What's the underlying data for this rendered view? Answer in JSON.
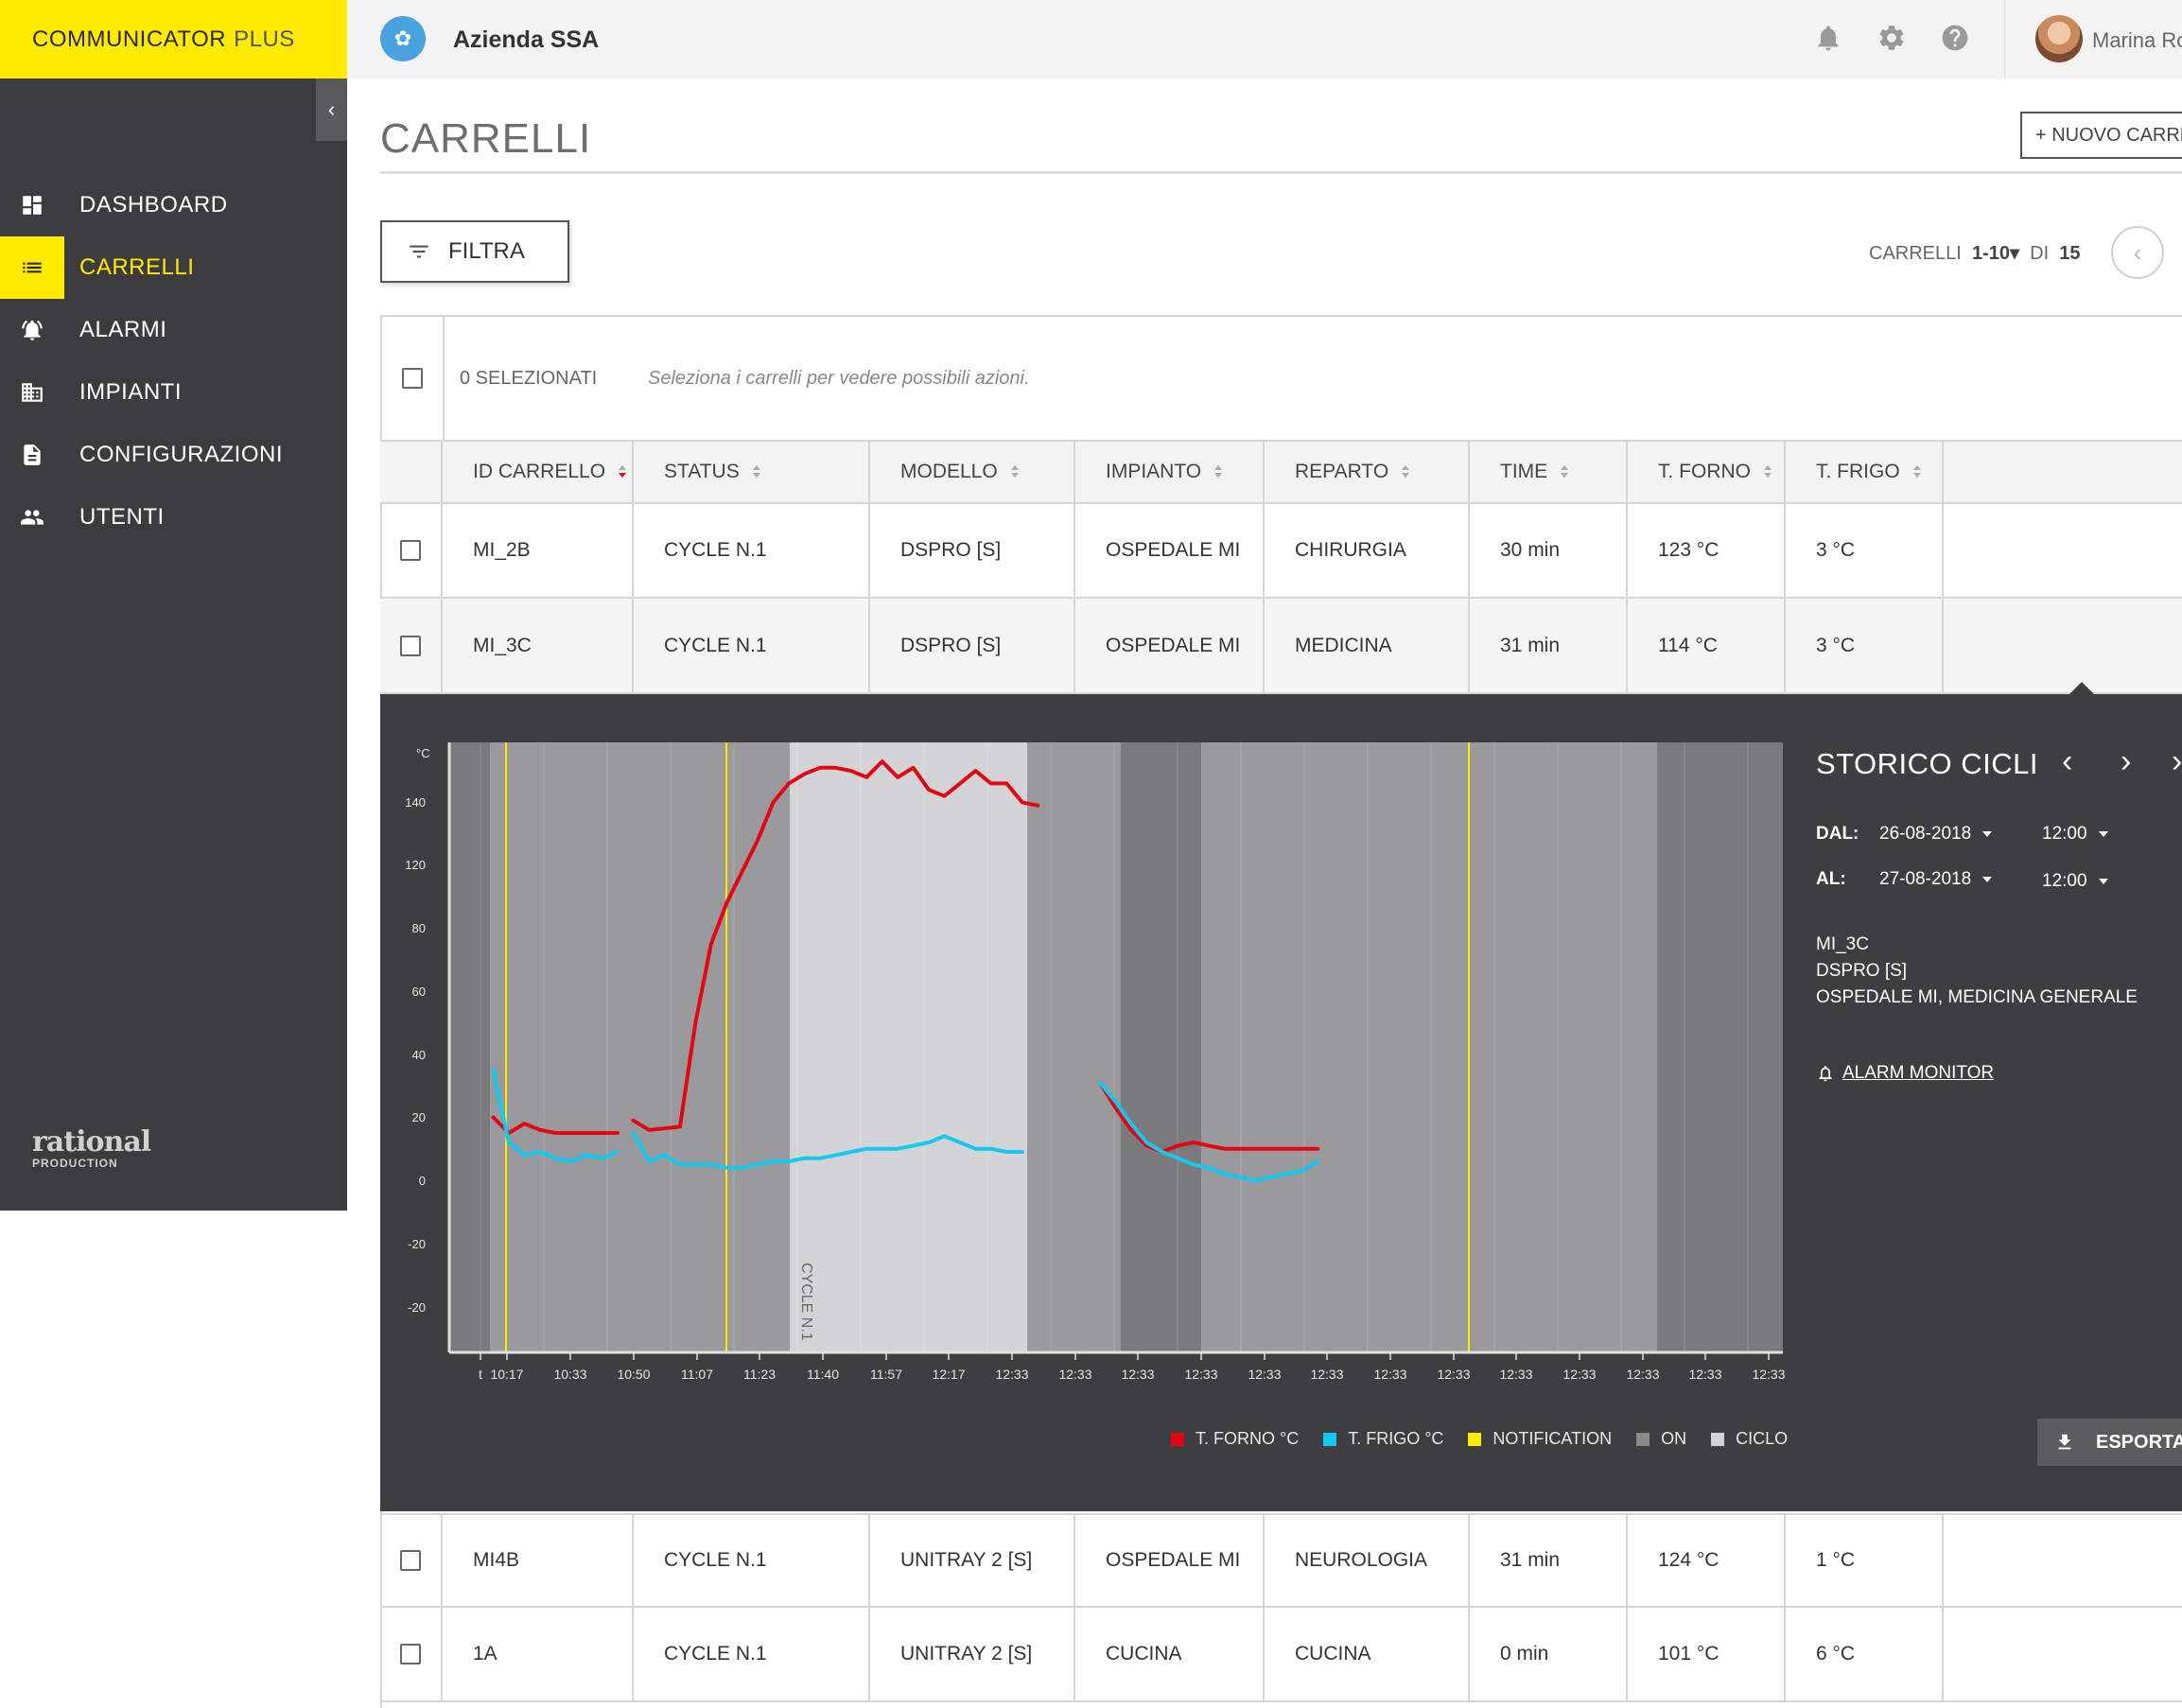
{
  "brand": {
    "name": "COMMUNICATOR",
    "suffix": "PLUS"
  },
  "sidebar": {
    "items": [
      {
        "label": "DASHBOARD",
        "icon": "dashboard-icon",
        "active": false
      },
      {
        "label": "CARRELLI",
        "icon": "list-icon",
        "active": true
      },
      {
        "label": "ALARMI",
        "icon": "alarm-bell-icon",
        "active": false
      },
      {
        "label": "IMPIANTI",
        "icon": "building-icon",
        "active": false
      },
      {
        "label": "CONFIGURAZIONI",
        "icon": "document-icon",
        "active": false
      },
      {
        "label": "UTENTI",
        "icon": "users-icon",
        "active": false
      }
    ],
    "logo": {
      "line1": "rational",
      "line2": "PRODUCTION"
    }
  },
  "topbar": {
    "company": "Azienda SSA",
    "user": "Marina Rc",
    "icons": [
      "bell-icon",
      "gear-icon",
      "help-icon"
    ]
  },
  "page": {
    "title": "CARRELLI",
    "new_button": "+ NUOVO CARRE",
    "filter_button": "FILTRA",
    "pager": {
      "label": "CARRELLI",
      "range": "1-10",
      "of": "DI",
      "total": "15"
    }
  },
  "selection": {
    "count": "0 SELEZIONATI",
    "hint": "Seleziona i carrelli per vedere possibili azioni."
  },
  "table": {
    "columns": [
      "ID CARRELLO",
      "STATUS",
      "MODELLO",
      "IMPIANTO",
      "REPARTO",
      "TIME",
      "T. FORNO",
      "T. FRIGO"
    ],
    "rows": [
      {
        "id": "MI_2B",
        "status": "CYCLE N.1",
        "modello": "DSPRO [S]",
        "impianto": "OSPEDALE MI",
        "reparto": "CHIRURGIA",
        "time": "30 min",
        "forno": "123 °C",
        "frigo": "3 °C"
      },
      {
        "id": "MI_3C",
        "status": "CYCLE N.1",
        "modello": "DSPRO [S]",
        "impianto": "OSPEDALE MI",
        "reparto": "MEDICINA",
        "time": "31 min",
        "forno": "114 °C",
        "frigo": "3 °C"
      },
      {
        "id": "MI4B",
        "status": "CYCLE N.1",
        "modello": "UNITRAY 2 [S]",
        "impianto": "OSPEDALE MI",
        "reparto": "NEUROLOGIA",
        "time": "31 min",
        "forno": "124 °C",
        "frigo": "1 °C"
      },
      {
        "id": "1A",
        "status": "CYCLE N.1",
        "modello": "UNITRAY 2 [S]",
        "impianto": "CUCINA",
        "reparto": "CUCINA",
        "time": "0 min",
        "forno": "101 °C",
        "frigo": "6 °C"
      }
    ],
    "row_action_icons": [
      "bell-icon",
      "trend-icon",
      "history-icon",
      "remote-icon"
    ]
  },
  "storico": {
    "title": "STORICO CICLI",
    "dal_label": "DAL:",
    "dal_date": "26-08-2018",
    "dal_time": "12:00",
    "al_label": "AL:",
    "al_date": "27-08-2018",
    "al_time": "12:00",
    "cart": "MI_3C",
    "model": "DSPRO [S]",
    "location": "OSPEDALE MI, MEDICINA GENERALE",
    "alarm_link": "ALARM MONITOR",
    "export": "ESPORTA"
  },
  "chart_data": {
    "type": "line",
    "ylabel": "°C",
    "ytick_labels": [
      "140",
      "120",
      "80",
      "60",
      "40",
      "20",
      "0",
      "-20",
      "-20"
    ],
    "xtick_labels": [
      "t",
      "10:17",
      "10:33",
      "10:50",
      "11:07",
      "11:23",
      "11:40",
      "11:57",
      "12:17",
      "12:33",
      "12:33",
      "12:33",
      "12:33",
      "12:33",
      "12:33",
      "12:33",
      "12:33",
      "12:33",
      "12:33",
      "12:33",
      "12:33",
      "12:33"
    ],
    "cycle_label": "CYCLE N.1",
    "series": [
      {
        "name": "T. FORNO °C",
        "color": "#e30613",
        "segments": [
          [
            [
              1,
              20
            ],
            [
              2,
              15
            ],
            [
              3,
              18
            ],
            [
              4,
              16
            ],
            [
              5,
              15
            ],
            [
              6,
              15
            ],
            [
              7,
              15
            ],
            [
              8,
              15
            ],
            [
              9,
              15
            ]
          ],
          [
            [
              10,
              19
            ],
            [
              11,
              16
            ],
            [
              12,
              16.5
            ],
            [
              13,
              17
            ],
            [
              14,
              50
            ],
            [
              15,
              75
            ],
            [
              16,
              88
            ],
            [
              17,
              98
            ],
            [
              18,
              108
            ],
            [
              19,
              120
            ],
            [
              20,
              126
            ],
            [
              21,
              129
            ],
            [
              22,
              131
            ],
            [
              23,
              131
            ],
            [
              24,
              130
            ],
            [
              25,
              128
            ],
            [
              26,
              133
            ],
            [
              27,
              128
            ],
            [
              28,
              131
            ],
            [
              29,
              124
            ],
            [
              30,
              122
            ],
            [
              31,
              126
            ],
            [
              32,
              130
            ],
            [
              33,
              126
            ],
            [
              34,
              126
            ],
            [
              35,
              120
            ],
            [
              36,
              119
            ]
          ],
          [
            [
              40,
              31
            ],
            [
              41,
              23
            ],
            [
              42,
              16
            ],
            [
              43,
              11
            ],
            [
              44,
              9
            ],
            [
              45,
              11
            ],
            [
              46,
              12
            ],
            [
              47,
              11
            ],
            [
              48,
              10
            ],
            [
              49,
              10
            ],
            [
              50,
              10
            ],
            [
              51,
              10
            ],
            [
              52,
              10
            ],
            [
              53,
              10
            ],
            [
              54,
              10
            ]
          ]
        ]
      },
      {
        "name": "T. FRIGO °C",
        "color": "#14c8f0",
        "segments": [
          [
            [
              1,
              35
            ],
            [
              2,
              12
            ],
            [
              3,
              8
            ],
            [
              4,
              9
            ],
            [
              5,
              7
            ],
            [
              6,
              6
            ],
            [
              7,
              8
            ],
            [
              8,
              7
            ],
            [
              9,
              9
            ]
          ],
          [
            [
              10,
              15
            ],
            [
              11,
              6
            ],
            [
              12,
              8
            ],
            [
              13,
              5
            ],
            [
              14,
              5
            ],
            [
              15,
              5
            ],
            [
              16,
              4
            ],
            [
              17,
              4
            ],
            [
              18,
              5
            ],
            [
              19,
              6
            ],
            [
              20,
              6
            ],
            [
              21,
              7
            ],
            [
              22,
              7
            ],
            [
              23,
              8
            ],
            [
              24,
              9
            ],
            [
              25,
              10
            ],
            [
              26,
              10
            ],
            [
              27,
              10
            ],
            [
              28,
              11
            ],
            [
              29,
              12
            ],
            [
              30,
              14
            ],
            [
              31,
              12
            ],
            [
              32,
              10
            ],
            [
              33,
              10
            ],
            [
              34,
              9
            ],
            [
              35,
              9
            ]
          ],
          [
            [
              40,
              31
            ],
            [
              41,
              25
            ],
            [
              42,
              18
            ],
            [
              43,
              12
            ],
            [
              44,
              9
            ],
            [
              45,
              7
            ],
            [
              46,
              5
            ],
            [
              47,
              4
            ],
            [
              48,
              2
            ],
            [
              49,
              1
            ],
            [
              50,
              0
            ],
            [
              51,
              1
            ],
            [
              52,
              2
            ],
            [
              53,
              3
            ],
            [
              54,
              6
            ]
          ]
        ]
      }
    ],
    "legend": [
      {
        "label": "T. FORNO °C",
        "color": "#e30613"
      },
      {
        "label": "T. FRIGO °C",
        "color": "#14c8f0"
      },
      {
        "label": "NOTIFICATION",
        "color": "#ffea00"
      },
      {
        "label": "ON",
        "color": "#8a8a8a"
      },
      {
        "label": "CICLO",
        "color": "#d4d4d6"
      }
    ]
  }
}
